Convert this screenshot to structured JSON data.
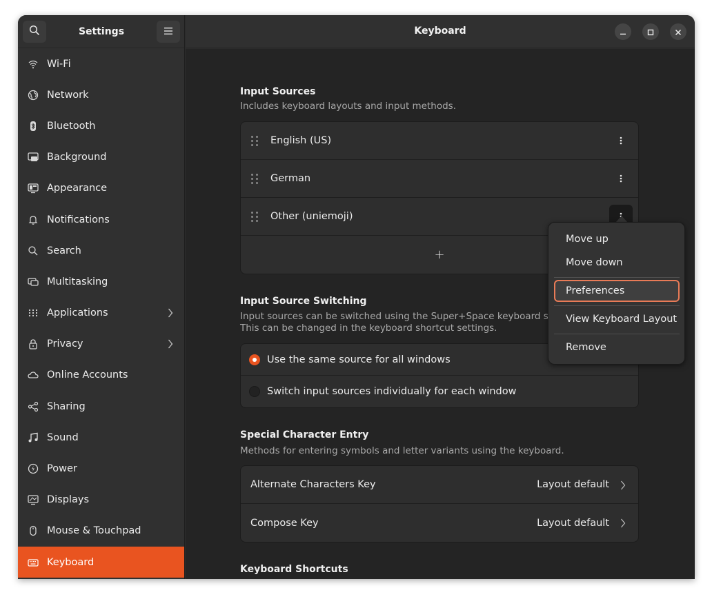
{
  "sidebar": {
    "title": "Settings",
    "items": [
      {
        "label": "Wi-Fi",
        "icon": "wifi-icon"
      },
      {
        "label": "Network",
        "icon": "globe-icon"
      },
      {
        "label": "Bluetooth",
        "icon": "bluetooth-icon"
      },
      {
        "label": "Background",
        "icon": "background-icon"
      },
      {
        "label": "Appearance",
        "icon": "appearance-icon"
      },
      {
        "label": "Notifications",
        "icon": "bell-icon"
      },
      {
        "label": "Search",
        "icon": "search-icon"
      },
      {
        "label": "Multitasking",
        "icon": "multitasking-icon"
      },
      {
        "label": "Applications",
        "icon": "apps-grid-icon"
      },
      {
        "label": "Privacy",
        "icon": "lock-icon"
      },
      {
        "label": "Online Accounts",
        "icon": "cloud-icon"
      },
      {
        "label": "Sharing",
        "icon": "share-icon"
      },
      {
        "label": "Sound",
        "icon": "music-note-icon"
      },
      {
        "label": "Power",
        "icon": "power-icon"
      },
      {
        "label": "Displays",
        "icon": "display-icon"
      },
      {
        "label": "Mouse & Touchpad",
        "icon": "mouse-icon"
      },
      {
        "label": "Keyboard",
        "icon": "keyboard-icon",
        "active": true
      }
    ]
  },
  "header": {
    "title": "Keyboard"
  },
  "input_sources": {
    "title": "Input Sources",
    "subtitle": "Includes keyboard layouts and input methods.",
    "items": [
      "English (US)",
      "German",
      "Other (uniemoji)"
    ],
    "add_label": "+"
  },
  "switching": {
    "title": "Input Source Switching",
    "subtitle_line1": "Input sources can be switched using the Super+Space keyboard sho",
    "subtitle_line2": "This can be changed in the keyboard shortcut settings.",
    "options": [
      "Use the same source for all windows",
      "Switch input sources individually for each window"
    ],
    "selected": 0
  },
  "special": {
    "title": "Special Character Entry",
    "subtitle": "Methods for entering symbols and letter variants using the keyboard.",
    "rows": [
      {
        "label": "Alternate Characters Key",
        "value": "Layout default"
      },
      {
        "label": "Compose Key",
        "value": "Layout default"
      }
    ]
  },
  "shortcuts": {
    "title": "Keyboard Shortcuts"
  },
  "menu": {
    "items": [
      "Move up",
      "Move down",
      "Preferences",
      "View Keyboard Layout",
      "Remove"
    ],
    "focused": "Preferences"
  },
  "colors": {
    "accent": "#e95420",
    "focus_ring": "#e97b57",
    "background": "#242424"
  }
}
